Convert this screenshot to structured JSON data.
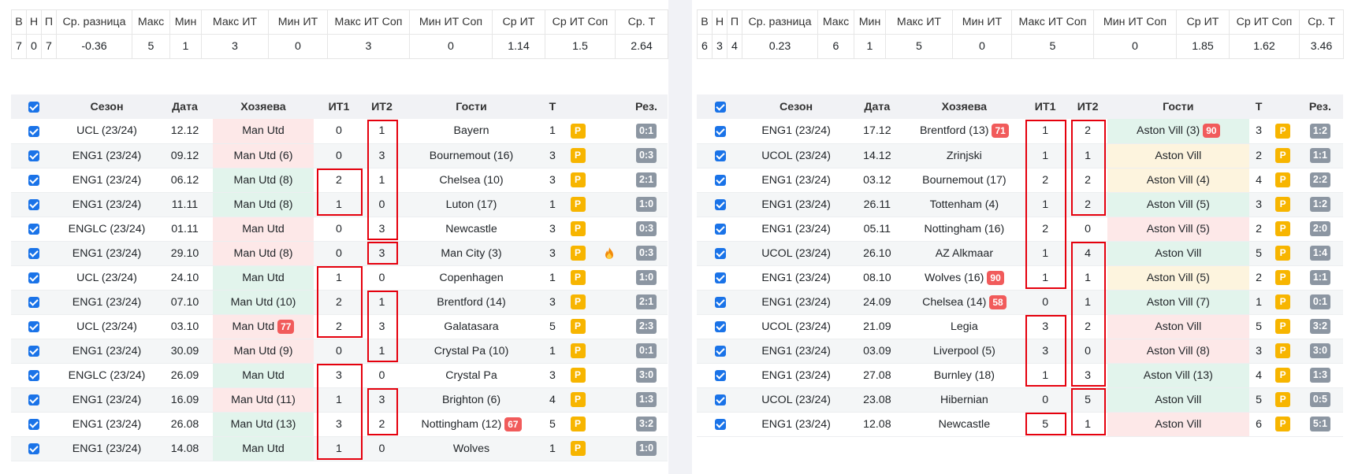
{
  "stats_headers": [
    "В",
    "Н",
    "П",
    "Ср. разница",
    "Макс",
    "Мин",
    "Макс ИТ",
    "Мин ИТ",
    "Макс ИТ Соп",
    "Мин ИТ Соп",
    "Ср ИТ",
    "Ср ИТ Соп",
    "Ср. Т"
  ],
  "match_headers": [
    "Сезон",
    "Дата",
    "Хозяева",
    "ИТ1",
    "ИТ2",
    "Гости",
    "Т",
    "Рез."
  ],
  "colors": {
    "win": "#e2f4ec",
    "loss": "#fde8e8",
    "draw": "#fdf4de",
    "badge": "#f15b5b",
    "p_badge": "#f7b500",
    "score": "#8c96a2",
    "highlight": "#e5000d",
    "checkbox": "#1a73e8"
  },
  "panels": [
    {
      "stats": [
        "7",
        "0",
        "7",
        "-0.36",
        "5",
        "1",
        "3",
        "0",
        "3",
        "0",
        "1.14",
        "1.5",
        "2.64"
      ],
      "rows": [
        {
          "season": "UCL (23/24)",
          "date": "12.12",
          "home": "Man Utd",
          "it1": "0",
          "it2": "1",
          "away": "Bayern",
          "t": "1",
          "p": "P",
          "score": "0:1",
          "side": "home",
          "res": "l"
        },
        {
          "season": "ENG1 (23/24)",
          "date": "09.12",
          "home": "Man Utd (6)",
          "it1": "0",
          "it2": "3",
          "away": "Bournemout (16)",
          "t": "3",
          "p": "P",
          "score": "0:3",
          "side": "home",
          "res": "l"
        },
        {
          "season": "ENG1 (23/24)",
          "date": "06.12",
          "home": "Man Utd (8)",
          "it1": "2",
          "it2": "1",
          "away": "Chelsea (10)",
          "t": "3",
          "p": "P",
          "score": "2:1",
          "side": "home",
          "res": "w"
        },
        {
          "season": "ENG1 (23/24)",
          "date": "11.11",
          "home": "Man Utd (8)",
          "it1": "1",
          "it2": "0",
          "away": "Luton (17)",
          "t": "1",
          "p": "P",
          "score": "1:0",
          "side": "home",
          "res": "w"
        },
        {
          "season": "ENGLC (23/24)",
          "date": "01.11",
          "home": "Man Utd",
          "it1": "0",
          "it2": "3",
          "away": "Newcastle",
          "t": "3",
          "p": "P",
          "score": "0:3",
          "side": "home",
          "res": "l"
        },
        {
          "season": "ENG1 (23/24)",
          "date": "29.10",
          "home": "Man Utd (8)",
          "it1": "0",
          "it2": "3",
          "away": "Man City (3)",
          "t": "3",
          "p": "P",
          "score": "0:3",
          "side": "home",
          "res": "l",
          "fire": true
        },
        {
          "season": "UCL (23/24)",
          "date": "24.10",
          "home": "Man Utd",
          "it1": "1",
          "it2": "0",
          "away": "Copenhagen",
          "t": "1",
          "p": "P",
          "score": "1:0",
          "side": "home",
          "res": "w"
        },
        {
          "season": "ENG1 (23/24)",
          "date": "07.10",
          "home": "Man Utd (10)",
          "it1": "2",
          "it2": "1",
          "away": "Brentford (14)",
          "t": "3",
          "p": "P",
          "score": "2:1",
          "side": "home",
          "res": "w"
        },
        {
          "season": "UCL (23/24)",
          "date": "03.10",
          "home": "Man Utd",
          "home_badge": "77",
          "it1": "2",
          "it2": "3",
          "away": "Galatasara",
          "t": "5",
          "p": "P",
          "score": "2:3",
          "side": "home",
          "res": "l"
        },
        {
          "season": "ENG1 (23/24)",
          "date": "30.09",
          "home": "Man Utd (9)",
          "it1": "0",
          "it2": "1",
          "away": "Crystal Pa (10)",
          "t": "1",
          "p": "P",
          "score": "0:1",
          "side": "home",
          "res": "l"
        },
        {
          "season": "ENGLC (23/24)",
          "date": "26.09",
          "home": "Man Utd",
          "it1": "3",
          "it2": "0",
          "away": "Crystal Pa",
          "t": "3",
          "p": "P",
          "score": "3:0",
          "side": "home",
          "res": "w"
        },
        {
          "season": "ENG1 (23/24)",
          "date": "16.09",
          "home": "Man Utd (11)",
          "it1": "1",
          "it2": "3",
          "away": "Brighton (6)",
          "t": "4",
          "p": "P",
          "score": "1:3",
          "side": "home",
          "res": "l"
        },
        {
          "season": "ENG1 (23/24)",
          "date": "26.08",
          "home": "Man Utd (13)",
          "it1": "3",
          "it2": "2",
          "away": "Nottingham (12)",
          "away_badge": "67",
          "t": "5",
          "p": "P",
          "score": "3:2",
          "side": "home",
          "res": "w"
        },
        {
          "season": "ENG1 (23/24)",
          "date": "14.08",
          "home": "Man Utd",
          "it1": "1",
          "it2": "0",
          "away": "Wolves",
          "t": "1",
          "p": "P",
          "score": "1:0",
          "side": "home",
          "res": "w"
        }
      ]
    },
    {
      "stats": [
        "6",
        "3",
        "4",
        "0.23",
        "6",
        "1",
        "5",
        "0",
        "5",
        "0",
        "1.85",
        "1.62",
        "3.46"
      ],
      "rows": [
        {
          "season": "ENG1 (23/24)",
          "date": "17.12",
          "home": "Brentford (13)",
          "home_badge": "71",
          "it1": "1",
          "it2": "2",
          "away": "Aston Vill (3)",
          "away_badge": "90",
          "t": "3",
          "p": "P",
          "score": "1:2",
          "side": "away",
          "res": "w"
        },
        {
          "season": "UCOL (23/24)",
          "date": "14.12",
          "home": "Zrinjski",
          "it1": "1",
          "it2": "1",
          "away": "Aston Vill",
          "t": "2",
          "p": "P",
          "score": "1:1",
          "side": "away",
          "res": "d"
        },
        {
          "season": "ENG1 (23/24)",
          "date": "03.12",
          "home": "Bournemout (17)",
          "it1": "2",
          "it2": "2",
          "away": "Aston Vill (4)",
          "t": "4",
          "p": "P",
          "score": "2:2",
          "side": "away",
          "res": "d"
        },
        {
          "season": "ENG1 (23/24)",
          "date": "26.11",
          "home": "Tottenham (4)",
          "it1": "1",
          "it2": "2",
          "away": "Aston Vill (5)",
          "t": "3",
          "p": "P",
          "score": "1:2",
          "side": "away",
          "res": "w"
        },
        {
          "season": "ENG1 (23/24)",
          "date": "05.11",
          "home": "Nottingham (16)",
          "it1": "2",
          "it2": "0",
          "away": "Aston Vill (5)",
          "t": "2",
          "p": "P",
          "score": "2:0",
          "side": "away",
          "res": "l"
        },
        {
          "season": "UCOL (23/24)",
          "date": "26.10",
          "home": "AZ Alkmaar",
          "it1": "1",
          "it2": "4",
          "away": "Aston Vill",
          "t": "5",
          "p": "P",
          "score": "1:4",
          "side": "away",
          "res": "w"
        },
        {
          "season": "ENG1 (23/24)",
          "date": "08.10",
          "home": "Wolves (16)",
          "home_badge": "90",
          "it1": "1",
          "it2": "1",
          "away": "Aston Vill (5)",
          "t": "2",
          "p": "P",
          "score": "1:1",
          "side": "away",
          "res": "d"
        },
        {
          "season": "ENG1 (23/24)",
          "date": "24.09",
          "home": "Chelsea (14)",
          "home_badge": "58",
          "it1": "0",
          "it2": "1",
          "away": "Aston Vill (7)",
          "t": "1",
          "p": "P",
          "score": "0:1",
          "side": "away",
          "res": "w"
        },
        {
          "season": "UCOL (23/24)",
          "date": "21.09",
          "home": "Legia",
          "it1": "3",
          "it2": "2",
          "away": "Aston Vill",
          "t": "5",
          "p": "P",
          "score": "3:2",
          "side": "away",
          "res": "l"
        },
        {
          "season": "ENG1 (23/24)",
          "date": "03.09",
          "home": "Liverpool (5)",
          "it1": "3",
          "it2": "0",
          "away": "Aston Vill (8)",
          "t": "3",
          "p": "P",
          "score": "3:0",
          "side": "away",
          "res": "l"
        },
        {
          "season": "ENG1 (23/24)",
          "date": "27.08",
          "home": "Burnley (18)",
          "it1": "1",
          "it2": "3",
          "away": "Aston Vill (13)",
          "t": "4",
          "p": "P",
          "score": "1:3",
          "side": "away",
          "res": "w"
        },
        {
          "season": "UCOL (23/24)",
          "date": "23.08",
          "home": "Hibernian",
          "it1": "0",
          "it2": "5",
          "away": "Aston Vill",
          "t": "5",
          "p": "P",
          "score": "0:5",
          "side": "away",
          "res": "w"
        },
        {
          "season": "ENG1 (23/24)",
          "date": "12.08",
          "home": "Newcastle",
          "it1": "5",
          "it2": "1",
          "away": "Aston Vill",
          "t": "6",
          "p": "P",
          "score": "5:1",
          "side": "away",
          "res": "l"
        }
      ]
    }
  ]
}
